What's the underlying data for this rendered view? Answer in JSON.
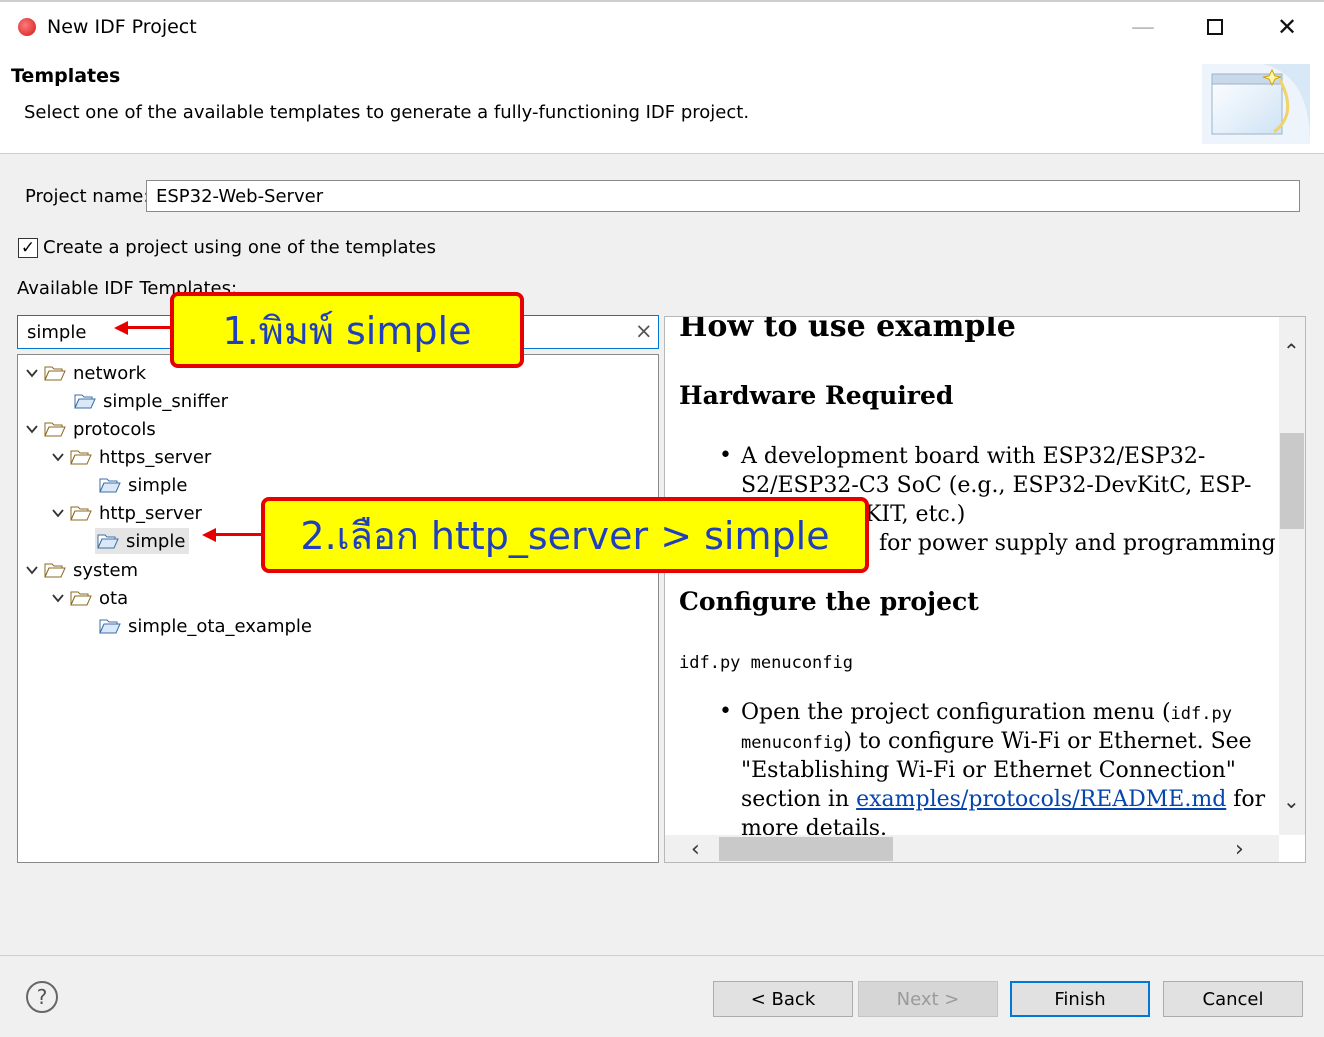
{
  "window": {
    "title": "New IDF Project",
    "minimize_icon": "minimize-icon",
    "maximize_icon": "maximize-icon",
    "close_icon": "close-icon"
  },
  "header": {
    "title": "Templates",
    "description": "Select one of the available templates to generate a fully-functioning IDF project."
  },
  "form": {
    "project_name_label": "Project name:",
    "project_name_value": "ESP32-Web-Server",
    "use_template_label": "Create a project using one of the templates",
    "use_template_checked": true,
    "available_label": "Available IDF Templates:",
    "filter_value": "simple"
  },
  "tree": {
    "items": [
      {
        "label": "network",
        "level": 0,
        "expanded": true,
        "type": "folder"
      },
      {
        "label": "simple_sniffer",
        "level": 1,
        "type": "template"
      },
      {
        "label": "protocols",
        "level": 0,
        "expanded": true,
        "type": "folder"
      },
      {
        "label": "https_server",
        "level": 1,
        "expanded": true,
        "type": "folder"
      },
      {
        "label": "simple",
        "level": 2,
        "type": "template"
      },
      {
        "label": "http_server",
        "level": 1,
        "expanded": true,
        "type": "folder"
      },
      {
        "label": "simple",
        "level": 2,
        "type": "template",
        "selected": true
      },
      {
        "label": "system",
        "level": 0,
        "expanded": true,
        "type": "folder"
      },
      {
        "label": "ota",
        "level": 1,
        "expanded": true,
        "type": "folder"
      },
      {
        "label": "simple_ota_example",
        "level": 2,
        "type": "template"
      }
    ]
  },
  "readme": {
    "heading_main": "How to use example",
    "heading_hw": "Hardware Required",
    "hw_line1": "A development board with ESP32/ESP32-",
    "hw_line2": "S2/ESP32-C3 SoC (e.g., ESP32-DevKitC, ESP-",
    "hw_line3": "KIT, etc.)",
    "hw_line4": "for power supply and programming",
    "heading_config": "Configure the project",
    "config_cmd": "idf.py menuconfig",
    "cfg_line1a": "Open the project configuration menu (",
    "cfg_line1b": "idf.py",
    "cfg_line2a": "menuconfig",
    "cfg_line2b": ") to configure Wi-Fi or Ethernet. See",
    "cfg_line3": "\"Establishing Wi-Fi or Ethernet Connection\"",
    "cfg_line4a": "section in ",
    "cfg_line4_link": "examples/protocols/README.md",
    "cfg_line4b": " for",
    "cfg_line5": "more details."
  },
  "callouts": {
    "step1": "1.พิมพ์ simple",
    "step2": "2.เลือก http_server > simple"
  },
  "footer": {
    "help": "?",
    "back": "< Back",
    "next": "Next >",
    "finish": "Finish",
    "cancel": "Cancel"
  },
  "colors": {
    "accent": "#0078d7",
    "callout_fill": "#ffff00",
    "callout_border": "#e60000",
    "callout_text": "#1f3fbf",
    "link": "#0645ad"
  }
}
